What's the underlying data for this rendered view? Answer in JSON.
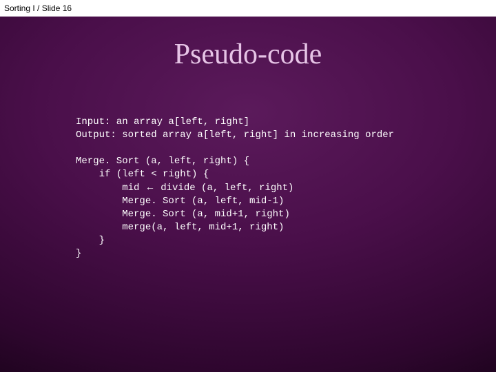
{
  "header": {
    "breadcrumb": "Sorting I  / Slide 16"
  },
  "title": "Pseudo-code",
  "code": {
    "l1": "Input: an array a[left, right]",
    "l2": "Output: sorted array a[left, right] in increasing order",
    "l3": "",
    "l4": "Merge. Sort (a, left, right) {",
    "l5": "    if (left < right) {",
    "l6pre": "        mid ",
    "arrow": "←",
    "l6post": " divide (a, left, right)",
    "l7": "        Merge. Sort (a, left, mid-1)",
    "l8": "        Merge. Sort (a, mid+1, right)",
    "l9": "        merge(a, left, mid+1, right)",
    "l10": "    }",
    "l11": "}"
  }
}
